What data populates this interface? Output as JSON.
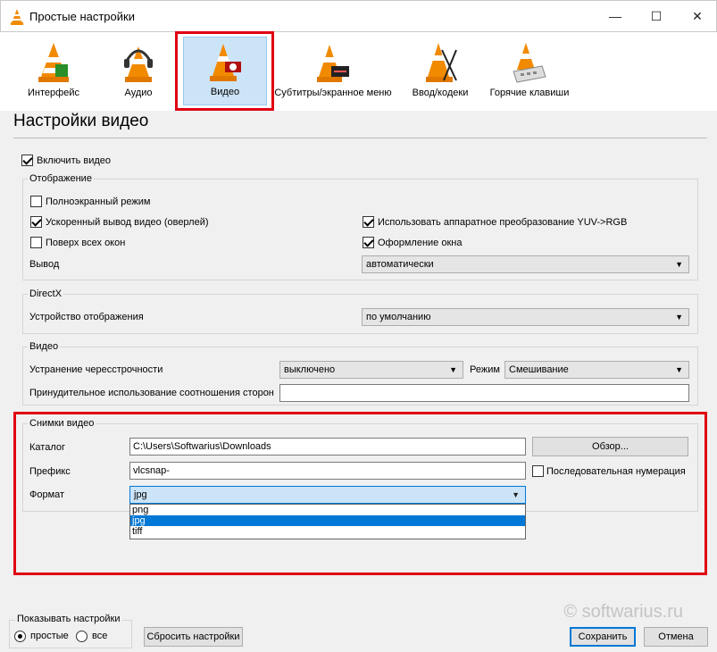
{
  "window": {
    "title": "Простые настройки",
    "minimize": "—",
    "maximize": "☐",
    "close": "✕"
  },
  "toolbar": {
    "items": [
      {
        "label": "Интерфейс",
        "icon": "cone-interface-icon"
      },
      {
        "label": "Аудио",
        "icon": "cone-headphones-icon"
      },
      {
        "label": "Видео",
        "icon": "cone-film-icon",
        "selected": true
      },
      {
        "label": "Субтитры/экранное меню",
        "icon": "cone-subtitles-icon"
      },
      {
        "label": "Ввод/кодеки",
        "icon": "cone-codecs-icon"
      },
      {
        "label": "Горячие клавиши",
        "icon": "cone-keyboard-icon"
      }
    ]
  },
  "page": {
    "title": "Настройки видео",
    "enable_video": {
      "label": "Включить видео",
      "checked": true
    }
  },
  "display_group": {
    "title": "Отображение",
    "fullscreen": {
      "label": "Полноэкранный режим",
      "checked": false
    },
    "overlay": {
      "label": "Ускоренный вывод видео (оверлей)",
      "checked": true
    },
    "on_top": {
      "label": "Поверх всех окон",
      "checked": false
    },
    "yuv": {
      "label": "Использовать аппаратное преобразование YUV->RGB",
      "checked": true
    },
    "decorations": {
      "label": "Оформление окна",
      "checked": true
    },
    "output_label": "Вывод",
    "output_value": "автоматически"
  },
  "directx_group": {
    "title": "DirectX",
    "device_label": "Устройство отображения",
    "device_value": "по умолчанию"
  },
  "video_group": {
    "title": "Видео",
    "deinterlace_label": "Устранение чересстрочности",
    "deinterlace_value": "выключено",
    "mode_label": "Режим",
    "mode_value": "Смешивание",
    "aspect_label": "Принудительное использование соотношения сторон",
    "aspect_value": ""
  },
  "snapshot_group": {
    "title": "Снимки видео",
    "dir_label": "Каталог",
    "dir_value": "C:\\Users\\Softwarius\\Downloads",
    "browse_button": "Обзор...",
    "prefix_label": "Префикс",
    "prefix_value": "vlcsnap-",
    "sequential": {
      "label": "Последовательная нумерация",
      "checked": false
    },
    "format_label": "Формат",
    "format_value": "jpg",
    "format_options": [
      "png",
      "jpg",
      "tiff"
    ],
    "format_selected_index": 1
  },
  "footer": {
    "show_settings_title": "Показывать настройки",
    "simple": "простые",
    "all": "все",
    "simple_selected": true,
    "reset_button": "Сбросить настройки",
    "save_button": "Сохранить",
    "cancel_button": "Отмена"
  },
  "watermark": "© softwarius.ru",
  "colors": {
    "highlight_red": "#e00012",
    "selection_blue": "#0078d7",
    "toolbar_selected_bg": "#cce4f7"
  }
}
